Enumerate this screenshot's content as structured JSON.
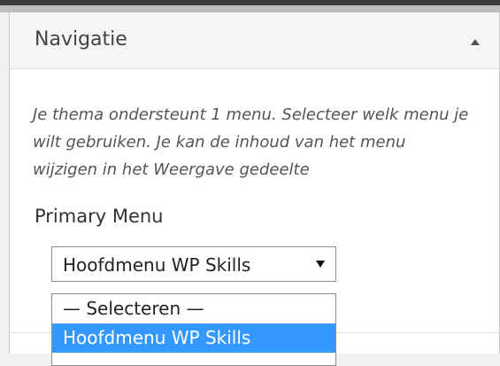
{
  "panel": {
    "title": "Navigatie",
    "description": "Je thema ondersteunt 1 menu. Selecteer welk menu je wilt gebruiken. Je kan de inhoud van het menu wijzigen in het Weergave gedeelte"
  },
  "menu_location": {
    "label": "Primary Menu",
    "selected_value": "Hoofdmenu WP Skills",
    "options": [
      "— Selecteren —",
      "Hoofdmenu WP Skills"
    ],
    "highlighted_index": 1
  },
  "colors": {
    "highlight": "#3399ff",
    "header_bg": "#f5f5f5"
  },
  "icons": {
    "collapse": "triangle-up-icon",
    "dropdown": "triangle-down-icon"
  }
}
